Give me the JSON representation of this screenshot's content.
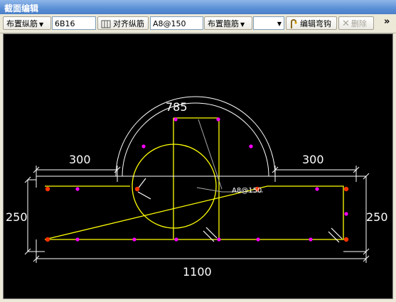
{
  "window": {
    "title": "截面编辑"
  },
  "toolbar": {
    "long_bar_menu": "布置纵筋",
    "long_bar_value": "6B16",
    "align_button": "对齐纵筋",
    "stirrup_value": "A8@150",
    "stirrup_menu": "布置箍筋",
    "edit_hook_button": "编辑弯钩",
    "delete_button": "删除",
    "more_glyph": "»"
  },
  "drawing": {
    "dim_arc": "785",
    "dim_left_top": "300",
    "dim_right_top": "300",
    "dim_left_side": "250",
    "dim_right_side": "250",
    "dim_bottom": "1100",
    "stirrup_label": "A8@150",
    "colors": {
      "section": "#ffff00",
      "dimension": "#ffffff",
      "bar": "#ff00ff",
      "corner_bar": "#ff3300"
    }
  }
}
